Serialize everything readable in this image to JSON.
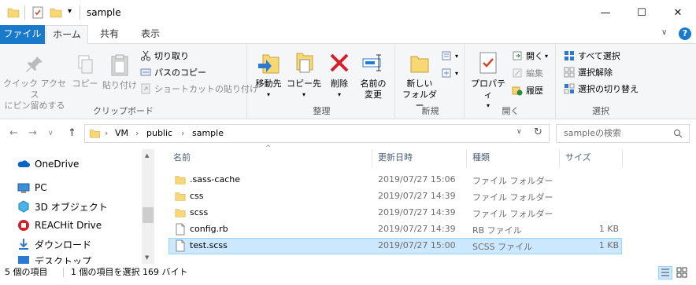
{
  "window": {
    "title": "sample",
    "controls": {
      "minimize": "—",
      "maximize": "☐",
      "close": "✕"
    }
  },
  "tabs": [
    {
      "label": "ファイル"
    },
    {
      "label": "ホーム"
    },
    {
      "label": "共有"
    },
    {
      "label": "表示"
    }
  ],
  "ribbon": {
    "clipboard": {
      "group_label": "クリップボード",
      "pin_line1": "クイック アクセス",
      "pin_line2": "にピン留めする",
      "copy": "コピー",
      "paste": "貼り付け",
      "cut": "切り取り",
      "copy_path": "パスのコピー",
      "paste_shortcut": "ショートカットの貼り付け"
    },
    "organize": {
      "group_label": "整理",
      "move_to": "移動先",
      "copy_to": "コピー先",
      "delete": "削除",
      "rename_line1": "名前の",
      "rename_line2": "変更"
    },
    "new": {
      "group_label": "新規",
      "new_folder_line1": "新しい",
      "new_folder_line2": "フォルダー"
    },
    "open": {
      "group_label": "開く",
      "properties": "プロパティ",
      "open": "開く",
      "edit": "編集",
      "history": "履歴"
    },
    "select": {
      "group_label": "選択",
      "select_all": "すべて選択",
      "select_none": "選択解除",
      "invert": "選択の切り替え"
    }
  },
  "address": {
    "path": [
      "VM",
      "public",
      "sample"
    ],
    "separator": "›",
    "search_placeholder": "sampleの検索"
  },
  "nav_pane": {
    "items": [
      {
        "label": "OneDrive",
        "icon": "onedrive-icon"
      },
      {
        "label": "PC",
        "icon": "pc-icon"
      },
      {
        "label": "3D オブジェクト",
        "icon": "3d-objects-icon"
      },
      {
        "label": "REACHit Drive",
        "icon": "reachit-drive-icon"
      },
      {
        "label": "ダウンロード",
        "icon": "download-icon"
      },
      {
        "label": "デスクトップ",
        "icon": "desktop-icon"
      }
    ]
  },
  "file_list": {
    "columns": [
      "名前",
      "更新日時",
      "種類",
      "サイズ"
    ],
    "rows": [
      {
        "name": ".sass-cache",
        "date": "2019/07/27 15:06",
        "type": "ファイル フォルダー",
        "size": "",
        "kind": "folder"
      },
      {
        "name": "css",
        "date": "2019/07/27 14:39",
        "type": "ファイル フォルダー",
        "size": "",
        "kind": "folder"
      },
      {
        "name": "scss",
        "date": "2019/07/27 14:39",
        "type": "ファイル フォルダー",
        "size": "",
        "kind": "folder"
      },
      {
        "name": "config.rb",
        "date": "2019/07/27 14:39",
        "type": "RB ファイル",
        "size": "1 KB",
        "kind": "file"
      },
      {
        "name": "test.scss",
        "date": "2019/07/27 15:00",
        "type": "SCSS ファイル",
        "size": "1 KB",
        "kind": "file",
        "selected": true
      }
    ]
  },
  "status": {
    "item_count": "5 個の項目",
    "selection": "1 個の項目を選択  169 バイト"
  },
  "colors": {
    "accent": "#1979ca",
    "selection_bg": "#cce8ff",
    "selection_border": "#99d1ff",
    "folder": "#f8d775"
  }
}
